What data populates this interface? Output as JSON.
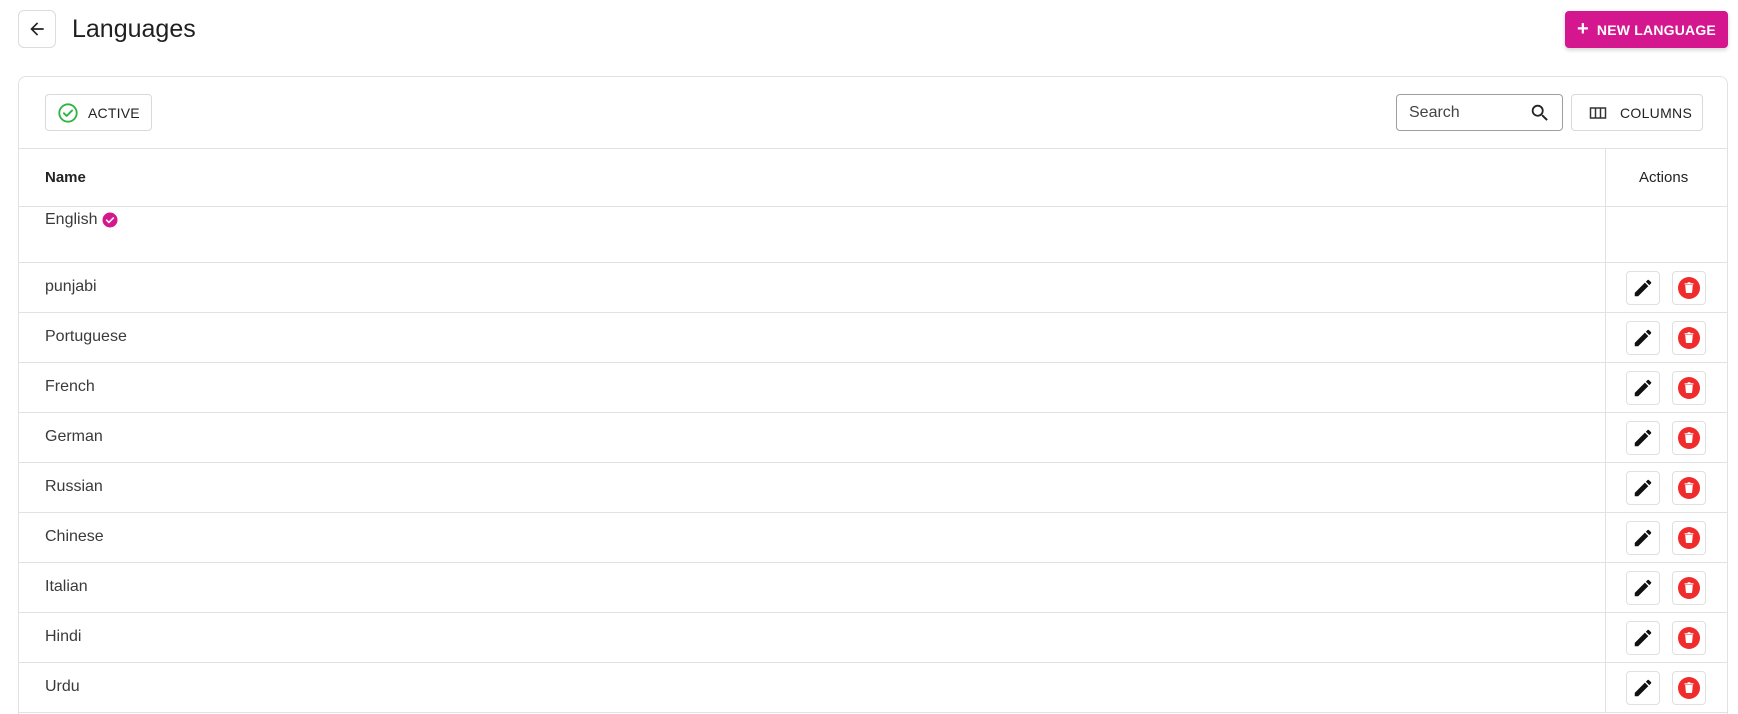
{
  "header": {
    "title": "Languages",
    "new_button_label": "NEW LANGUAGE",
    "accent_color": "#d4168f"
  },
  "toolbar": {
    "active_filter_label": "ACTIVE",
    "search_placeholder": "Search",
    "search_value": "",
    "columns_label": "COLUMNS"
  },
  "table": {
    "columns": {
      "name": "Name",
      "actions": "Actions"
    },
    "rows": [
      {
        "name": "English",
        "default": true
      },
      {
        "name": "punjabi"
      },
      {
        "name": "Portuguese"
      },
      {
        "name": "French"
      },
      {
        "name": "German"
      },
      {
        "name": "Russian"
      },
      {
        "name": "Chinese"
      },
      {
        "name": "Italian"
      },
      {
        "name": "Hindi"
      },
      {
        "name": "Urdu"
      }
    ]
  },
  "icons": {
    "back": "arrow-left-icon",
    "plus": "plus-icon",
    "active": "check-circle-icon",
    "search": "search-icon",
    "columns": "view-column-icon",
    "verified": "verified-badge-icon",
    "edit": "pencil-icon",
    "delete": "trash-icon"
  },
  "colors": {
    "delete": "#f02b2b",
    "active_check": "#2fb344",
    "verified_badge": "#d4168f"
  }
}
